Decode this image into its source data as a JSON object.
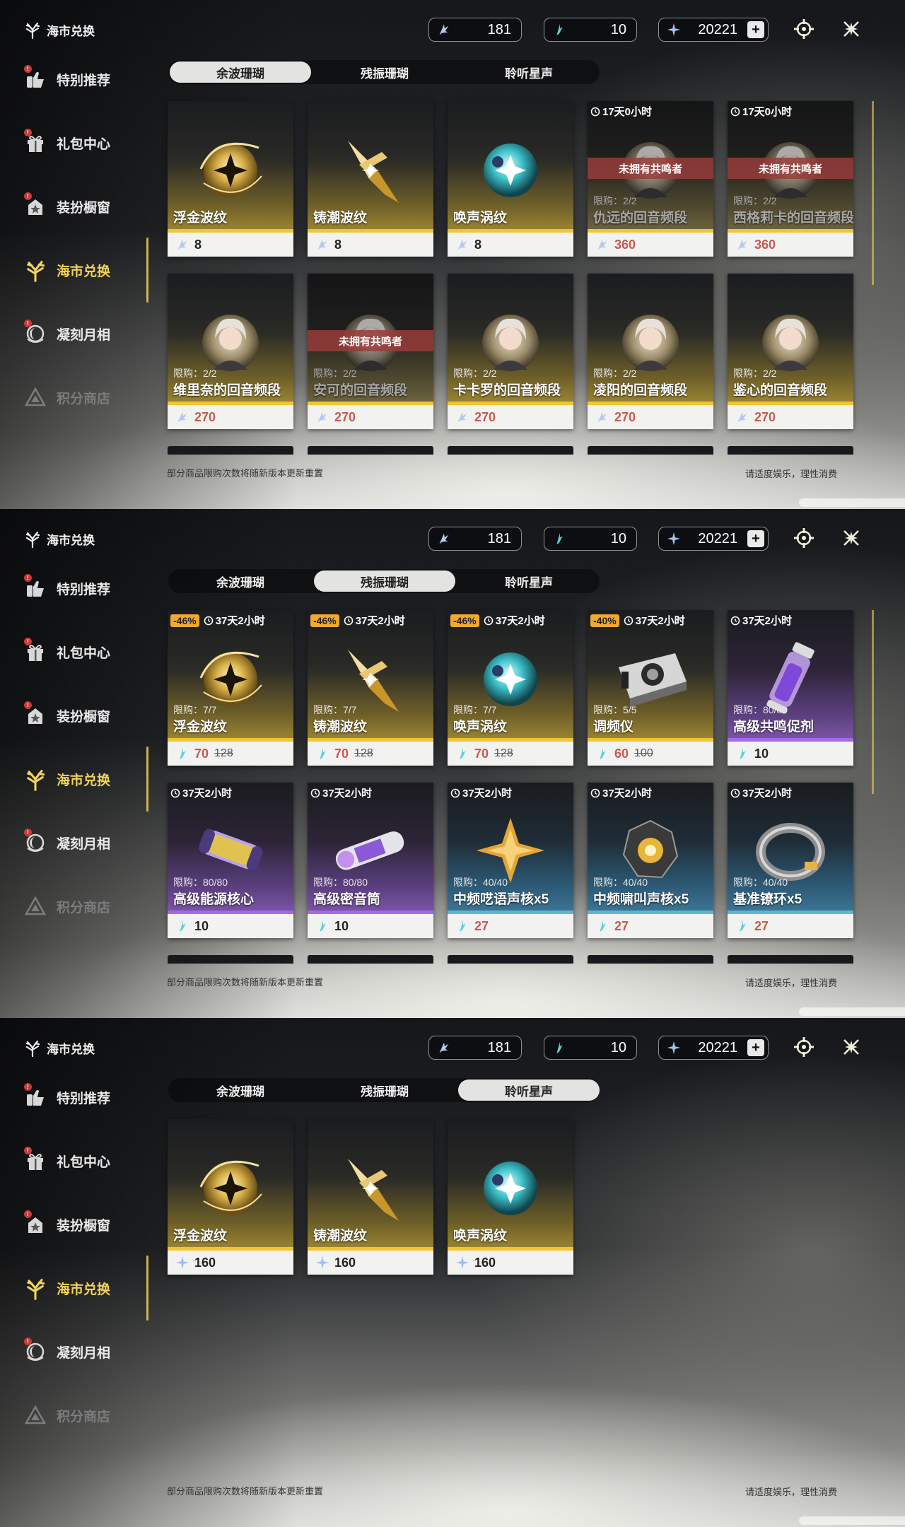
{
  "app": {
    "shop_title": "海市兑换",
    "currencies": [
      {
        "name": "oscillated-coral-icon",
        "value": "181"
      },
      {
        "name": "afterglow-coral-icon",
        "value": "10"
      },
      {
        "name": "astrite-icon",
        "value": "20221",
        "has_plus": true
      }
    ],
    "sidebar": [
      {
        "label": "特别推荐",
        "icon": "recommend-icon",
        "badge": "!"
      },
      {
        "label": "礼包中心",
        "icon": "gift-icon",
        "badge": "!"
      },
      {
        "label": "装扮橱窗",
        "icon": "wardrobe-icon",
        "badge": "!"
      },
      {
        "label": "海市兑换",
        "icon": "coral-exchange-icon",
        "active": true
      },
      {
        "label": "凝刻月相",
        "icon": "moon-phase-icon",
        "badge": "!"
      },
      {
        "label": "积分商店",
        "icon": "points-shop-icon",
        "dimmed": true
      }
    ],
    "tabs": [
      "余波珊瑚",
      "残振珊瑚",
      "聆听星声"
    ],
    "footer_left": "部分商品限购次数将随新版本更新重置",
    "footer_right": "请适度娱乐，理性消费"
  },
  "screens": [
    {
      "active_tab": 0,
      "cards": [
        {
          "name": "浮金波纹",
          "price": "8",
          "currency": "oscillated",
          "art": "gold-sphere",
          "theme": "gold"
        },
        {
          "name": "铸潮波纹",
          "price": "8",
          "currency": "oscillated",
          "art": "gold-blade",
          "theme": "gold"
        },
        {
          "name": "唤声涡纹",
          "price": "8",
          "currency": "oscillated",
          "art": "teal-sphere",
          "theme": "gold"
        },
        {
          "name": "仇远的回音频段",
          "price": "360",
          "currency": "oscillated",
          "timer": "17天0小时",
          "limit": "限购：2/2",
          "owned": "未拥有共鸣者",
          "art": "portrait",
          "theme": "gold",
          "greyed": true,
          "red": true
        },
        {
          "name": "西格莉卡的回音频段",
          "price": "360",
          "currency": "oscillated",
          "timer": "17天0小时",
          "limit": "限购：2/2",
          "owned": "未拥有共鸣者",
          "art": "portrait",
          "theme": "gold",
          "greyed": true,
          "red": true
        },
        {
          "name": "维里奈的回音频段",
          "price": "270",
          "currency": "oscillated",
          "limit": "限购：2/2",
          "art": "portrait",
          "theme": "gold",
          "red": true
        },
        {
          "name": "安可的回音频段",
          "price": "270",
          "currency": "oscillated",
          "limit": "限购：2/2",
          "owned": "未拥有共鸣者",
          "art": "portrait",
          "theme": "gold",
          "greyed": true,
          "red": true
        },
        {
          "name": "卡卡罗的回音频段",
          "price": "270",
          "currency": "oscillated",
          "limit": "限购：2/2",
          "art": "portrait",
          "theme": "gold",
          "red": true
        },
        {
          "name": "凌阳的回音频段",
          "price": "270",
          "currency": "oscillated",
          "limit": "限购：2/2",
          "art": "portrait",
          "theme": "gold",
          "red": true
        },
        {
          "name": "鉴心的回音频段",
          "price": "270",
          "currency": "oscillated",
          "limit": "限购：2/2",
          "art": "portrait",
          "theme": "gold",
          "red": true
        }
      ],
      "partial_row": true
    },
    {
      "active_tab": 1,
      "cards": [
        {
          "name": "浮金波纹",
          "price": "70",
          "old_price": "128",
          "discount": "-46%",
          "timer": "37天2小时",
          "limit": "限购：7/7",
          "currency": "afterglow",
          "art": "gold-sphere",
          "theme": "gold",
          "red": true
        },
        {
          "name": "铸潮波纹",
          "price": "70",
          "old_price": "128",
          "discount": "-46%",
          "timer": "37天2小时",
          "limit": "限购：7/7",
          "currency": "afterglow",
          "art": "gold-blade",
          "theme": "gold",
          "red": true
        },
        {
          "name": "唤声涡纹",
          "price": "70",
          "old_price": "128",
          "discount": "-46%",
          "timer": "37天2小时",
          "limit": "限购：7/7",
          "currency": "afterglow",
          "art": "teal-sphere",
          "theme": "gold",
          "red": true
        },
        {
          "name": "调频仪",
          "price": "60",
          "old_price": "100",
          "discount": "-40%",
          "timer": "37天2小时",
          "limit": "限购：5/5",
          "currency": "afterglow",
          "art": "device",
          "theme": "gold",
          "red": true
        },
        {
          "name": "高级共鸣促剂",
          "price": "10",
          "timer": "37天2小时",
          "limit": "限购：80/80",
          "currency": "afterglow",
          "art": "vial",
          "theme": "purple"
        },
        {
          "name": "高级能源核心",
          "price": "10",
          "timer": "37天2小时",
          "limit": "限购：80/80",
          "currency": "afterglow",
          "art": "capsule",
          "theme": "purple"
        },
        {
          "name": "高级密音筒",
          "price": "10",
          "timer": "37天2小时",
          "limit": "限购：80/80",
          "currency": "afterglow",
          "art": "cylinder",
          "theme": "purple"
        },
        {
          "name": "中频呓语声核x5",
          "price": "27",
          "timer": "37天2小时",
          "limit": "限购：40/40",
          "currency": "afterglow",
          "art": "star-core",
          "theme": "blue",
          "red": true
        },
        {
          "name": "中频啸叫声核x5",
          "price": "27",
          "timer": "37天2小时",
          "limit": "限购：40/40",
          "currency": "afterglow",
          "art": "dark-core",
          "theme": "blue",
          "red": true
        },
        {
          "name": "基准镣环x5",
          "price": "27",
          "timer": "37天2小时",
          "limit": "限购：40/40",
          "currency": "afterglow",
          "art": "ring",
          "theme": "blue",
          "red": true
        }
      ],
      "partial_row": true
    },
    {
      "active_tab": 2,
      "cards": [
        {
          "name": "浮金波纹",
          "price": "160",
          "currency": "astrite",
          "art": "gold-sphere",
          "theme": "gold"
        },
        {
          "name": "铸潮波纹",
          "price": "160",
          "currency": "astrite",
          "art": "gold-blade",
          "theme": "gold"
        },
        {
          "name": "唤声涡纹",
          "price": "160",
          "currency": "astrite",
          "art": "teal-sphere",
          "theme": "gold"
        }
      ],
      "partial_row": false
    }
  ],
  "colors": {
    "accent_gold": "#f0c636",
    "active_text": "#f1d35a",
    "price_red": "#c45a52",
    "purple": "#a46ae8",
    "blue": "#5fb6d6"
  }
}
